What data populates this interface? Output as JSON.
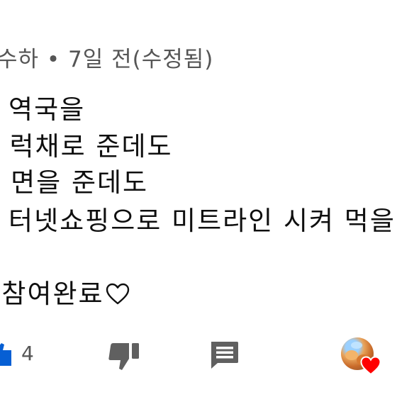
{
  "comment": {
    "meta": "수하 • 7일 전(수정됨)",
    "lines": [
      "l 역국을",
      ". 럭채로 준데도",
      "- 면을 준데도",
      "l 터넷쇼핑으로 미트라인 시켜 먹을",
      ")참여완료"
    ],
    "text_heart_icon": "heart-outline-icon"
  },
  "actions": {
    "like_icon": "thumb-up-icon",
    "like_count": "4",
    "dislike_icon": "thumb-down-icon",
    "reply_icon": "reply-comment-icon",
    "creator_avatar_icon": "creator-avatar",
    "creator_heart_icon": "red-heart-icon"
  },
  "colors": {
    "text": "#0f0f0f",
    "meta": "#555555",
    "like_blue": "#065fd4",
    "icon_gray": "#606060",
    "heart_red": "#ff0000"
  }
}
